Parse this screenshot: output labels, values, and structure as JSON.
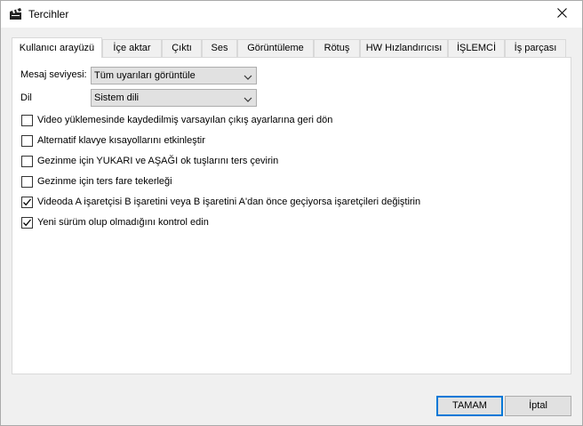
{
  "window": {
    "title": "Tercihler",
    "app_icon": "clapperboard-icon",
    "close_icon": "close-icon"
  },
  "tabs": [
    {
      "label": "Kullanıcı arayüzü",
      "active": true
    },
    {
      "label": "İçe aktar"
    },
    {
      "label": "Çıktı"
    },
    {
      "label": "Ses"
    },
    {
      "label": "Görüntüleme"
    },
    {
      "label": "Rötuş"
    },
    {
      "label": "HW Hızlandırıcısı"
    },
    {
      "label": "İŞLEMCİ"
    },
    {
      "label": "İş parçası"
    }
  ],
  "fields": {
    "message_level": {
      "label": "Mesaj seviyesi:",
      "value": "Tüm uyarıları görüntüle"
    },
    "language": {
      "label": "Dil",
      "value": "Sistem dili"
    }
  },
  "options": [
    {
      "label": "Video yüklemesinde kaydedilmiş varsayılan çıkış ayarlarına geri dön",
      "checked": false
    },
    {
      "label": " Alternatif klavye kısayollarını etkinleştir",
      "checked": false
    },
    {
      "label": "Gezinme için YUKARI ve AŞAĞI ok tuşlarını ters çevirin",
      "checked": false
    },
    {
      "label": "Gezinme için ters fare tekerleği",
      "checked": false
    },
    {
      "label": "Videoda A işaretçisi B işaretini veya B işaretini A'dan önce geçiyorsa işaretçileri değiştirin",
      "checked": true
    },
    {
      "label": "Yeni sürüm olup olmadığını kontrol edin",
      "checked": true
    }
  ],
  "buttons": {
    "ok": "TAMAM",
    "cancel": "İptal"
  }
}
